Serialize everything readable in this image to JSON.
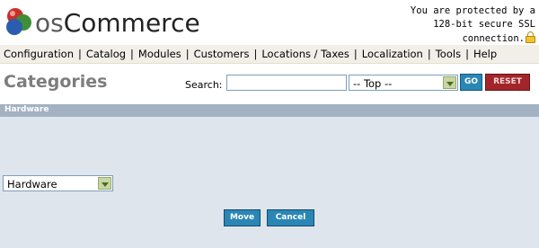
{
  "logo": {
    "text_os": "os",
    "text_rest": "Commerce",
    "colors": [
      "#c9302c",
      "#3f8e3a",
      "#2a5db0"
    ]
  },
  "ssl_notice": {
    "line1": "You are protected by a",
    "line2": "128-bit secure SSL",
    "line3": "connection."
  },
  "menu": {
    "items": [
      "Configuration",
      "Catalog",
      "Modules",
      "Customers",
      "Locations / Taxes",
      "Localization",
      "Tools",
      "Help"
    ],
    "separator": "|"
  },
  "page": {
    "title": "Categories"
  },
  "search": {
    "label": "Search:",
    "value": "",
    "category_selected": "-- Top --",
    "go_label": "GO",
    "reset_label": "RESET"
  },
  "panel": {
    "heading": "Hardware",
    "move_target_selected": "Hardware",
    "move_label": "Move",
    "cancel_label": "Cancel"
  }
}
